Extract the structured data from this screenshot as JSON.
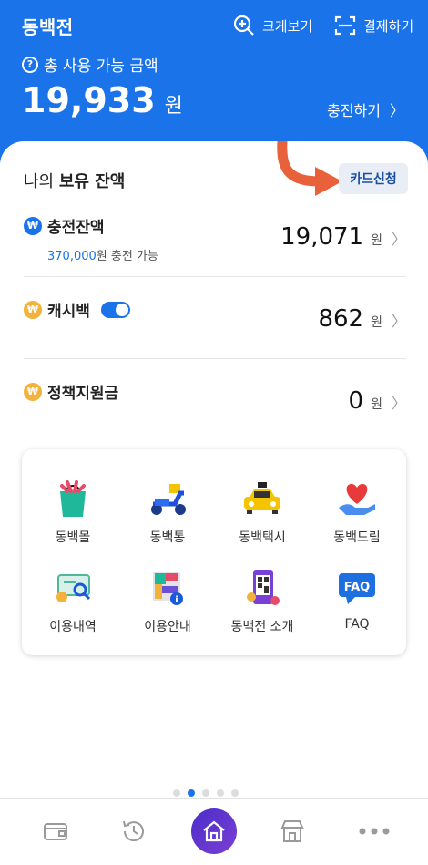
{
  "header": {
    "app_name": "동백전",
    "zoom_label": "크게보기",
    "pay_label": "결제하기",
    "available_label": "총 사용 가능 금액",
    "total_amount": "19,933",
    "unit": "원",
    "charge_label": "충전하기"
  },
  "balance": {
    "title_prefix": "나의 ",
    "title_bold": "보유 잔액",
    "card_apply_label": "카드신청",
    "rows": [
      {
        "label": "충전잔액",
        "sub_amount": "370,000",
        "sub_text": "원 충전 가능",
        "amount": "19,071",
        "unit": "원"
      },
      {
        "label": "캐시백",
        "amount": "862",
        "unit": "원"
      },
      {
        "label": "정책지원금",
        "amount": "0",
        "unit": "원"
      }
    ]
  },
  "menu": [
    {
      "label": "동백몰",
      "icon": "shopping-bag-icon"
    },
    {
      "label": "동백통",
      "icon": "scooter-icon"
    },
    {
      "label": "동백택시",
      "icon": "taxi-icon"
    },
    {
      "label": "동백드림",
      "icon": "heart-hand-icon"
    },
    {
      "label": "이용내역",
      "icon": "history-card-icon"
    },
    {
      "label": "이용안내",
      "icon": "guide-map-icon"
    },
    {
      "label": "동백전 소개",
      "icon": "phone-qr-icon"
    },
    {
      "label": "FAQ",
      "icon": "faq-bubble-icon"
    }
  ],
  "faq_icon_text": "FAQ",
  "colors": {
    "primary": "#1a73e8",
    "annotation_arrow": "#e8613a",
    "home_button": "#5a34cf"
  }
}
